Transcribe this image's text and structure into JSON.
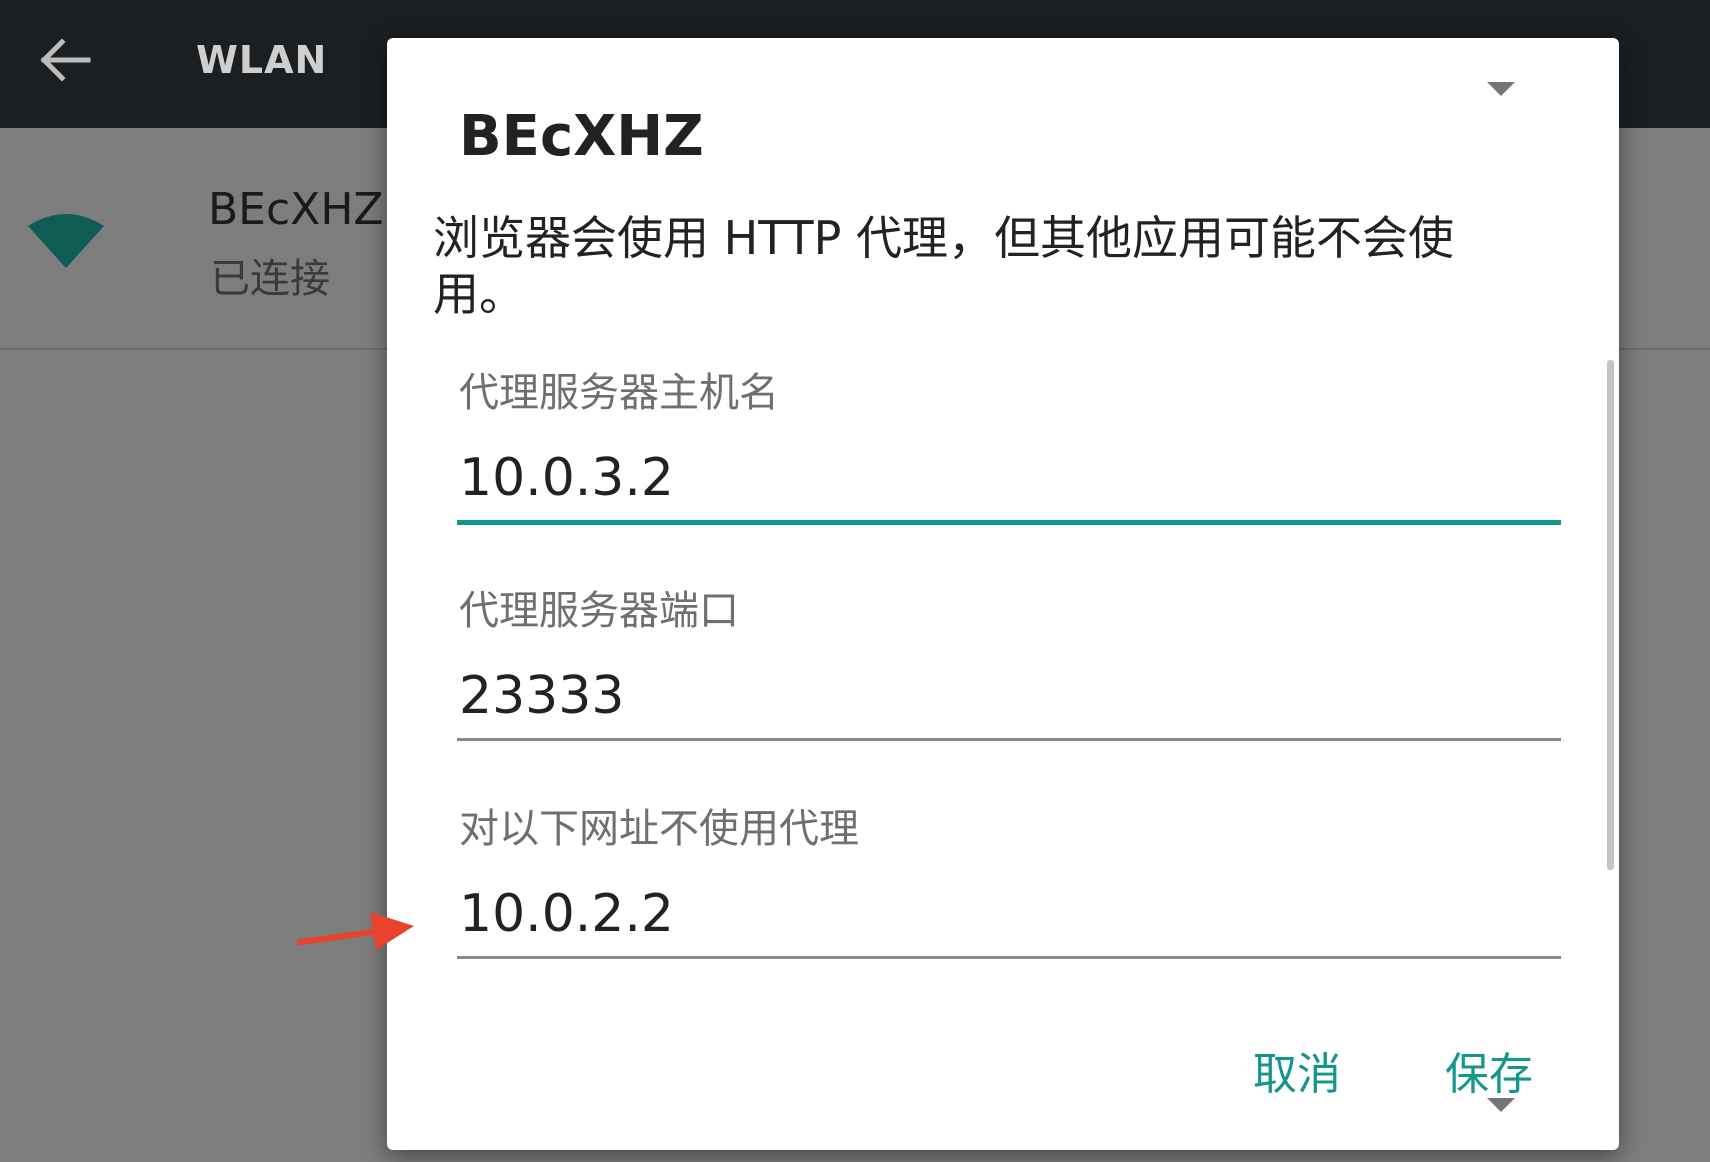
{
  "colors": {
    "accent": "#14968c",
    "toolbar": "#1b1f22",
    "scrim_background": "#7d7d7d",
    "wifi": "#0f5c55",
    "annotation_arrow": "#e8412c"
  },
  "toolbar": {
    "back_icon": "arrow-left-icon",
    "title": "WLAN"
  },
  "network": {
    "icon": "wifi-signal-icon",
    "name": "BEcXHZ",
    "status": "已连接"
  },
  "dialog": {
    "title": "BEcXHZ",
    "message": "浏览器会使用 HTTP 代理，但其他应用可能不会使用。",
    "fields": [
      {
        "label": "代理服务器主机名",
        "value": "10.0.3.2",
        "focused": true
      },
      {
        "label": "代理服务器端口",
        "value": "23333",
        "focused": false
      },
      {
        "label": "对以下网址不使用代理",
        "value": "10.0.2.2",
        "focused": false
      }
    ],
    "buttons": {
      "cancel": "取消",
      "save": "保存"
    }
  },
  "annotation": {
    "icon": "red-arrow-icon"
  }
}
